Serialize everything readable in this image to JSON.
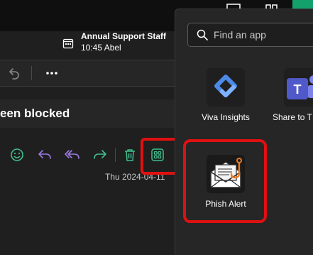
{
  "reminder": {
    "title": "Annual Support Staff",
    "time": "10:45 Abel"
  },
  "email": {
    "subject": "een blocked",
    "date": "Thu 2024-04-11"
  },
  "apps_panel": {
    "search_placeholder": "Find an app",
    "apps": [
      {
        "label": "Viva Insights"
      },
      {
        "label": "Share to T"
      },
      {
        "label": "Phish Alert"
      }
    ]
  },
  "colors": {
    "annotation_red": "#e01010",
    "action_green": "#3fbf8c",
    "action_purple": "#9b7be0"
  }
}
